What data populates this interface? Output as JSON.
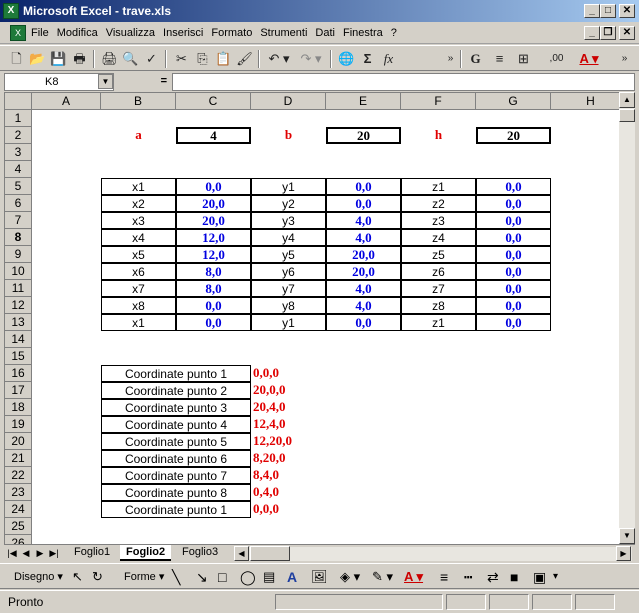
{
  "window": {
    "title": "Microsoft Excel - trave.xls",
    "min_btn": "_",
    "max_btn": "□",
    "close_btn": "✕"
  },
  "menu": {
    "items": [
      "File",
      "Modifica",
      "Visualizza",
      "Inserisci",
      "Formato",
      "Strumenti",
      "Dati",
      "Finestra",
      "?"
    ]
  },
  "formula_bar": {
    "name_box": "K8",
    "equals": "=",
    "content": ""
  },
  "columns": [
    "A",
    "B",
    "C",
    "D",
    "E",
    "F",
    "G",
    "H"
  ],
  "rows": [
    "1",
    "2",
    "3",
    "4",
    "5",
    "6",
    "7",
    "8",
    "9",
    "10",
    "11",
    "12",
    "13",
    "14",
    "15",
    "16",
    "17",
    "18",
    "19",
    "20",
    "21",
    "22",
    "23",
    "24",
    "25",
    "26"
  ],
  "selected_row": "8",
  "params": {
    "a_label": "a",
    "a_value": "4",
    "b_label": "b",
    "b_value": "20",
    "h_label": "h",
    "h_value": "20"
  },
  "coord_table": [
    {
      "xl": "x1",
      "xv": "0,0",
      "yl": "y1",
      "yv": "0,0",
      "zl": "z1",
      "zv": "0,0"
    },
    {
      "xl": "x2",
      "xv": "20,0",
      "yl": "y2",
      "yv": "0,0",
      "zl": "z2",
      "zv": "0,0"
    },
    {
      "xl": "x3",
      "xv": "20,0",
      "yl": "y3",
      "yv": "4,0",
      "zl": "z3",
      "zv": "0,0"
    },
    {
      "xl": "x4",
      "xv": "12,0",
      "yl": "y4",
      "yv": "4,0",
      "zl": "z4",
      "zv": "0,0"
    },
    {
      "xl": "x5",
      "xv": "12,0",
      "yl": "y5",
      "yv": "20,0",
      "zl": "z5",
      "zv": "0,0"
    },
    {
      "xl": "x6",
      "xv": "8,0",
      "yl": "y6",
      "yv": "20,0",
      "zl": "z6",
      "zv": "0,0"
    },
    {
      "xl": "x7",
      "xv": "8,0",
      "yl": "y7",
      "yv": "4,0",
      "zl": "z7",
      "zv": "0,0"
    },
    {
      "xl": "x8",
      "xv": "0,0",
      "yl": "y8",
      "yv": "4,0",
      "zl": "z8",
      "zv": "0,0"
    },
    {
      "xl": "x1",
      "xv": "0,0",
      "yl": "y1",
      "yv": "0,0",
      "zl": "z1",
      "zv": "0,0"
    }
  ],
  "points": [
    {
      "label": "Coordinate punto 1",
      "value": "0,0,0"
    },
    {
      "label": "Coordinate punto 2",
      "value": "20,0,0"
    },
    {
      "label": "Coordinate punto 3",
      "value": "20,4,0"
    },
    {
      "label": "Coordinate punto 4",
      "value": "12,4,0"
    },
    {
      "label": "Coordinate punto 5",
      "value": "12,20,0"
    },
    {
      "label": "Coordinate punto 6",
      "value": "8,20,0"
    },
    {
      "label": "Coordinate punto 7",
      "value": "8,4,0"
    },
    {
      "label": "Coordinate punto 8",
      "value": "0,4,0"
    },
    {
      "label": "Coordinate punto 1",
      "value": "0,0,0"
    }
  ],
  "sheets": {
    "tabs": [
      "Foglio1",
      "Foglio2",
      "Foglio3"
    ],
    "active": "Foglio2"
  },
  "drawing_toolbar": {
    "draw_label": "Disegno",
    "shapes_label": "Forme"
  },
  "status": {
    "text": "Pronto"
  },
  "colors": {
    "title_bar": "#0a246a",
    "value_blue": "#0000e0",
    "label_red": "#e00000",
    "chrome": "#d4d0c8"
  }
}
